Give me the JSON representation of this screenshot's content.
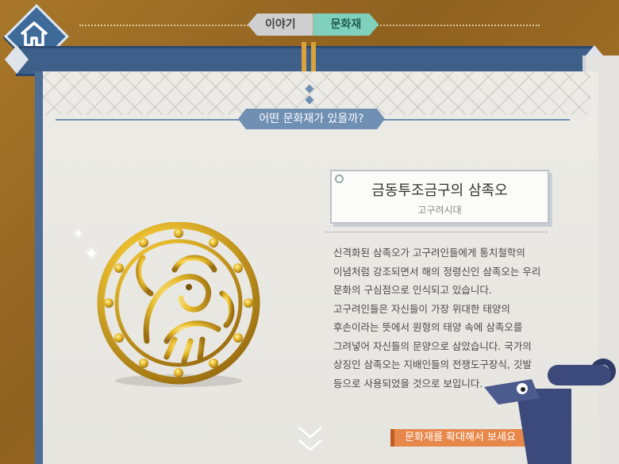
{
  "nav": {
    "home_icon": "home-icon",
    "tabs": [
      {
        "label": "이야기",
        "active": false
      },
      {
        "label": "문화재",
        "active": true
      }
    ]
  },
  "section": {
    "heading": "어떤 문화재가 있을까?"
  },
  "artifact": {
    "title": "금동투조금구의 삼족오",
    "period": "고구려시대",
    "description": "신격화된 삼족오가 고구려인들에게 통치철학의\n이념처럼 강조되면서 해의 정령신인 삼족오는 우리\n문화의 구심점으로 인식되고 있습니다.\n고구려인들은 자신들이 가장 위대한 태양의\n후손이라는 뜻에서 원형의 태양 속에 삼족오를\n그려넣어 자신들의 문양으로 삼았습니다. 국가의\n상징인 삼족오는 지배인들의 전쟁도구장식, 깃발\n등으로 사용되었을 것으로 보입니다."
  },
  "actions": {
    "zoom_label": "문화재를 확대해서 보세요",
    "scroll_icon": "chevron-down-icon"
  },
  "colors": {
    "accent_blue": "#3d5f8a",
    "tab_active": "#7fd0bd",
    "cta_orange": "#e8874a",
    "frame_brown": "#9c6b22"
  }
}
